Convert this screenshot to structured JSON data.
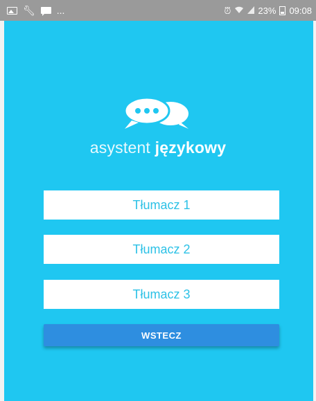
{
  "status_bar": {
    "more": "...",
    "battery_percent": "23%",
    "time": "09:08",
    "left_icons": [
      "gallery-icon",
      "wrench-icon",
      "message-icon"
    ],
    "right_icons": [
      "alarm-icon",
      "wifi-icon",
      "signal-icon",
      "battery-icon"
    ]
  },
  "logo": {
    "word_light": "asystent ",
    "word_bold": "językowy"
  },
  "buttons": {
    "translator1": "Tłumacz 1",
    "translator2": "Tłumacz 2",
    "translator3": "Tłumacz 3",
    "back": "WSTECZ"
  },
  "colors": {
    "background": "#1fc7f1",
    "button_text": "#2cc1e6",
    "back_button": "#2e8ee0"
  }
}
